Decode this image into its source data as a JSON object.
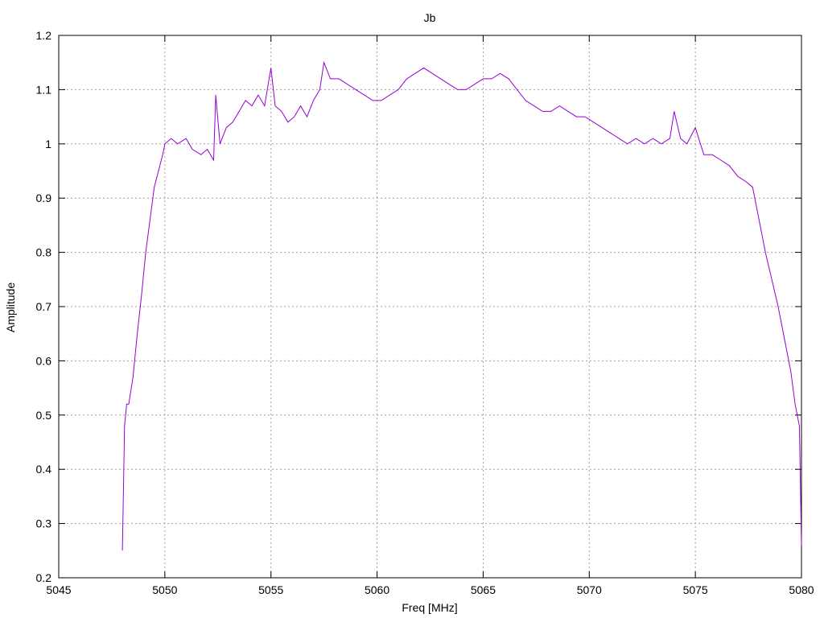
{
  "chart_data": {
    "type": "line",
    "title": "Jb",
    "xlabel": "Freq [MHz]",
    "ylabel": "Amplitude",
    "xlim": [
      5045,
      5080
    ],
    "ylim": [
      0.2,
      1.2
    ],
    "x_ticks": [
      5045,
      5050,
      5055,
      5060,
      5065,
      5070,
      5075,
      5080
    ],
    "y_ticks": [
      0.2,
      0.3,
      0.4,
      0.5,
      0.6,
      0.7,
      0.8,
      0.9,
      1.0,
      1.1,
      1.2
    ],
    "x_tick_labels": [
      "5045",
      "5050",
      "5055",
      "5060",
      "5065",
      "5070",
      "5075",
      "5080"
    ],
    "y_tick_labels": [
      "0.2",
      "0.3",
      "0.4",
      "0.5",
      "0.6",
      "0.7",
      "0.8",
      "0.9",
      "1",
      "1.1",
      "1.2"
    ],
    "grid": true,
    "line_color": "#9400d3",
    "series": [
      {
        "x": [
          5048.0,
          5048.1,
          5048.2,
          5048.3,
          5048.5,
          5048.7,
          5048.9,
          5049.1,
          5049.3,
          5049.5,
          5049.7,
          5049.9,
          5050.0,
          5050.3,
          5050.6,
          5051.0,
          5051.3,
          5051.7,
          5052.0,
          5052.3,
          5052.4,
          5052.6,
          5052.9,
          5053.2,
          5053.5,
          5053.8,
          5054.1,
          5054.4,
          5054.7,
          5055.0,
          5055.2,
          5055.5,
          5055.8,
          5056.1,
          5056.4,
          5056.7,
          5057.0,
          5057.3,
          5057.5,
          5057.8,
          5058.2,
          5058.6,
          5059.0,
          5059.4,
          5059.8,
          5060.2,
          5060.6,
          5061.0,
          5061.4,
          5061.8,
          5062.2,
          5062.6,
          5063.0,
          5063.4,
          5063.8,
          5064.2,
          5064.6,
          5065.0,
          5065.4,
          5065.8,
          5066.2,
          5066.6,
          5067.0,
          5067.4,
          5067.8,
          5068.2,
          5068.6,
          5069.0,
          5069.4,
          5069.8,
          5070.2,
          5070.6,
          5071.0,
          5071.4,
          5071.8,
          5072.2,
          5072.6,
          5073.0,
          5073.4,
          5073.8,
          5074.0,
          5074.3,
          5074.6,
          5075.0,
          5075.4,
          5075.8,
          5076.2,
          5076.6,
          5077.0,
          5077.4,
          5077.7,
          5078.0,
          5078.3,
          5078.6,
          5078.9,
          5079.2,
          5079.5,
          5079.7,
          5079.9,
          5080.0
        ],
        "y": [
          0.25,
          0.48,
          0.52,
          0.52,
          0.57,
          0.65,
          0.72,
          0.8,
          0.86,
          0.92,
          0.95,
          0.98,
          1.0,
          1.01,
          1.0,
          1.01,
          0.99,
          0.98,
          0.99,
          0.97,
          1.09,
          1.0,
          1.03,
          1.04,
          1.06,
          1.08,
          1.07,
          1.09,
          1.07,
          1.14,
          1.07,
          1.06,
          1.04,
          1.05,
          1.07,
          1.05,
          1.08,
          1.1,
          1.15,
          1.12,
          1.12,
          1.11,
          1.1,
          1.09,
          1.08,
          1.08,
          1.09,
          1.1,
          1.12,
          1.13,
          1.14,
          1.13,
          1.12,
          1.11,
          1.1,
          1.1,
          1.11,
          1.12,
          1.12,
          1.13,
          1.12,
          1.1,
          1.08,
          1.07,
          1.06,
          1.06,
          1.07,
          1.06,
          1.05,
          1.05,
          1.04,
          1.03,
          1.02,
          1.01,
          1.0,
          1.01,
          1.0,
          1.01,
          1.0,
          1.01,
          1.06,
          1.01,
          1.0,
          1.03,
          0.98,
          0.98,
          0.97,
          0.96,
          0.94,
          0.93,
          0.92,
          0.86,
          0.8,
          0.75,
          0.7,
          0.64,
          0.58,
          0.52,
          0.48,
          0.26
        ]
      }
    ]
  }
}
